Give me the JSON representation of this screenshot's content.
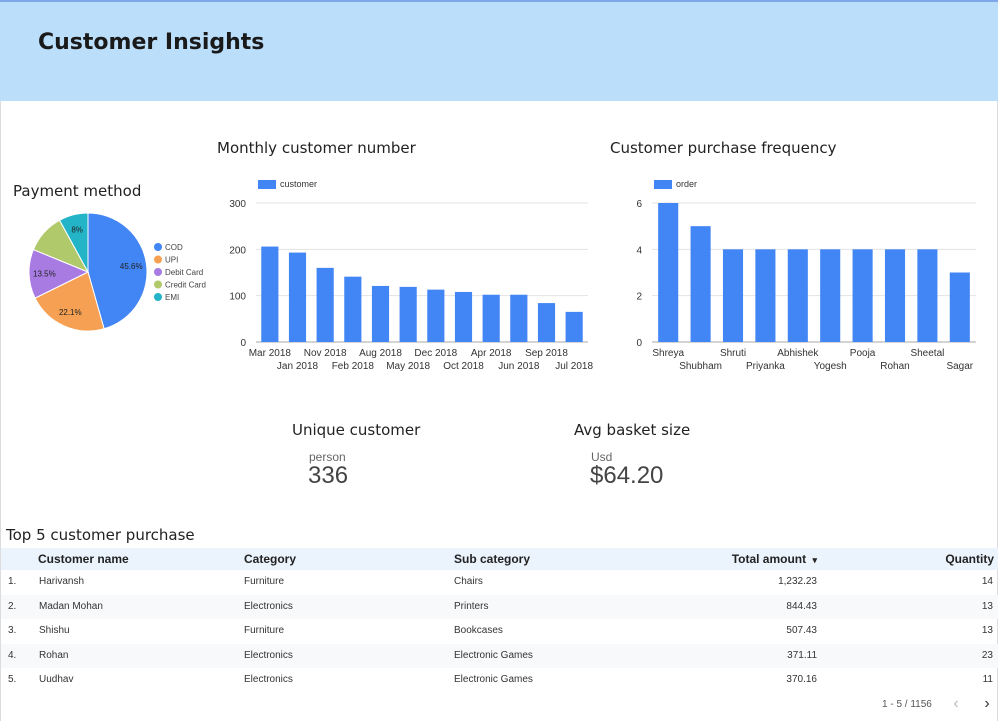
{
  "header": {
    "title": "Customer Insights"
  },
  "payment": {
    "title": "Payment method",
    "chart_data": {
      "type": "pie",
      "labels": [
        "COD",
        "UPI",
        "Debit Card",
        "Credit Card",
        "EMI"
      ],
      "values": [
        45.6,
        22.1,
        13.5,
        10.8,
        8.0
      ],
      "value_labels": [
        "45.6%",
        "22.1%",
        "13.5%",
        "",
        "8%"
      ],
      "colors": [
        "#4285f4",
        "#f5a052",
        "#a87be3",
        "#b0c96b",
        "#23b4c7"
      ],
      "legend": "right"
    }
  },
  "monthly": {
    "title": "Monthly customer number",
    "chart_data": {
      "type": "bar",
      "categories": [
        "Mar 2018",
        "Jan 2018",
        "Nov 2018",
        "Feb 2018",
        "Aug 2018",
        "May 2018",
        "Dec 2018",
        "Oct 2018",
        "Apr 2018",
        "Jun 2018",
        "Sep 2018",
        "Jul 2018"
      ],
      "series": [
        {
          "name": "customer",
          "values": [
            206,
            193,
            160,
            141,
            121,
            119,
            113,
            108,
            102,
            102,
            84,
            65
          ]
        }
      ],
      "ylim": [
        0,
        300
      ],
      "yticks": [
        "0",
        "100",
        "200",
        "300"
      ],
      "color": "#4285f4",
      "legend": "top-left",
      "grid": true
    }
  },
  "frequency": {
    "title": "Customer purchase frequency",
    "chart_data": {
      "type": "bar",
      "categories": [
        "Shreya",
        "Shubham",
        "Shruti",
        "Priyanka",
        "Abhishek",
        "Yogesh",
        "Pooja",
        "Rohan",
        "Sheetal",
        "Sagar"
      ],
      "series": [
        {
          "name": "order",
          "values": [
            6,
            5,
            4,
            4,
            4,
            4,
            4,
            4,
            4,
            3
          ]
        }
      ],
      "ylim": [
        0,
        6
      ],
      "yticks": [
        "0",
        "2",
        "4",
        "6"
      ],
      "color": "#4285f4",
      "legend": "top-left",
      "grid": true
    }
  },
  "scorecards": {
    "unique": {
      "title": "Unique customer",
      "label": "person",
      "value": "336"
    },
    "basket": {
      "title": "Avg basket size",
      "label": "Usd",
      "value": "$64.20"
    }
  },
  "table": {
    "title": "Top 5 customer purchase",
    "columns": [
      "Customer name",
      "Category",
      "Sub category",
      "Total amount",
      "Quantity"
    ],
    "sort_indicator": "▾",
    "rows": [
      {
        "idx": "1.",
        "name": "Harivansh",
        "category": "Furniture",
        "sub": "Chairs",
        "amount": "1,232.23",
        "qty": "14"
      },
      {
        "idx": "2.",
        "name": "Madan Mohan",
        "category": "Electronics",
        "sub": "Printers",
        "amount": "844.43",
        "qty": "13"
      },
      {
        "idx": "3.",
        "name": "Shishu",
        "category": "Furniture",
        "sub": "Bookcases",
        "amount": "507.43",
        "qty": "13"
      },
      {
        "idx": "4.",
        "name": "Rohan",
        "category": "Electronics",
        "sub": "Electronic Games",
        "amount": "371.11",
        "qty": "23"
      },
      {
        "idx": "5.",
        "name": "Uudhav",
        "category": "Electronics",
        "sub": "Electronic Games",
        "amount": "370.16",
        "qty": "11"
      }
    ],
    "pagination": "1 - 5 / 1156",
    "prev_icon": "‹",
    "next_icon": "›"
  }
}
